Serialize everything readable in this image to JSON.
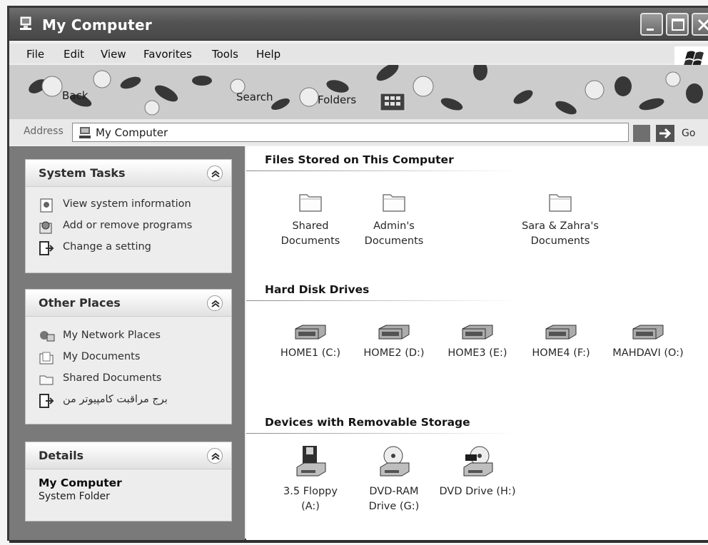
{
  "window": {
    "title": "My Computer"
  },
  "menu": [
    "File",
    "Edit",
    "View",
    "Favorites",
    "Tools",
    "Help"
  ],
  "toolbar": {
    "back": "Back",
    "search": "Search",
    "folders": "Folders"
  },
  "address": {
    "label": "Address",
    "value": "My Computer",
    "go": "Go"
  },
  "sidebar": {
    "system_tasks": {
      "title": "System Tasks",
      "items": [
        "View system information",
        "Add or remove programs",
        "Change a setting"
      ]
    },
    "other_places": {
      "title": "Other Places",
      "items": [
        "My Network Places",
        "My Documents",
        "Shared Documents",
        "برج مراقبت کامپیوتر من"
      ]
    },
    "details": {
      "title": "Details",
      "name": "My Computer",
      "type": "System Folder"
    }
  },
  "sections": {
    "files": {
      "title": "Files Stored on This Computer",
      "items": [
        {
          "line1": "Shared",
          "line2": "Documents"
        },
        {
          "line1": "Admin's",
          "line2": "Documents"
        },
        {
          "line1": "Sara & Zahra's",
          "line2": "Documents"
        }
      ]
    },
    "drives": {
      "title": "Hard Disk Drives",
      "items": [
        "HOME1 (C:)",
        "HOME2 (D:)",
        "HOME3 (E:)",
        "HOME4 (F:)",
        "MAHDAVI (O:)"
      ]
    },
    "removable": {
      "title": "Devices with Removable Storage",
      "items": [
        {
          "line1": "3.5 Floppy",
          "line2": "(A:)"
        },
        {
          "line1": "DVD-RAM",
          "line2": "Drive (G:)"
        },
        {
          "line1": "DVD Drive (H:)",
          "line2": ""
        }
      ]
    }
  }
}
